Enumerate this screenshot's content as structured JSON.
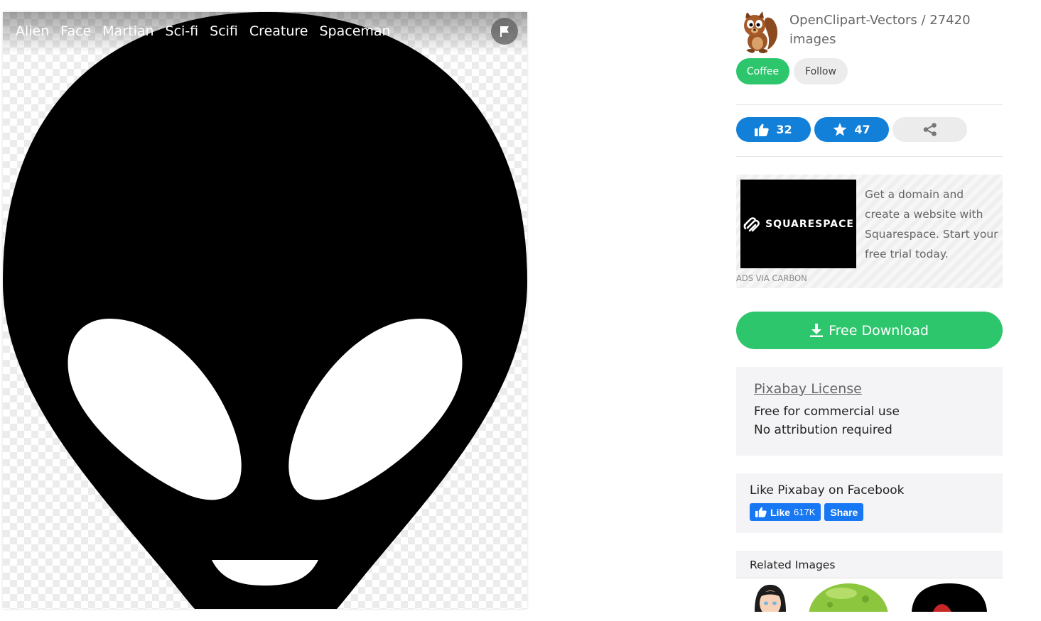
{
  "image": {
    "tags": [
      "Alien",
      "Face",
      "Martian",
      "Sci-fi",
      "Scifi",
      "Creature",
      "Spaceman"
    ],
    "flag_icon": "flag-icon"
  },
  "author": {
    "name": "OpenClipart-Vectors",
    "separator": " / ",
    "count": "27420",
    "count_suffix": " images",
    "coffee_label": "Coffee",
    "follow_label": "Follow"
  },
  "stats": {
    "likes": "32",
    "favorites": "47",
    "like_icon": "thumbs-up-icon",
    "favorite_icon": "star-icon",
    "share_icon": "share-icon"
  },
  "ad": {
    "brand": "SQUARESPACE",
    "text": "Get a domain and create a website with Squarespace. Start your free trial today.",
    "via": "ads via Carbon"
  },
  "download": {
    "label": "Free Download",
    "icon": "download-icon"
  },
  "license": {
    "title": "Pixabay License",
    "line1": "Free for commercial use",
    "line2": "No attribution required"
  },
  "facebook": {
    "title": "Like Pixabay on Facebook",
    "like_label": "Like",
    "like_count": "617K",
    "share_label": "Share"
  },
  "related": {
    "title": "Related Images"
  },
  "colors": {
    "green": "#2ec66d",
    "blue": "#1280d8",
    "facebook_blue": "#1877f2"
  }
}
